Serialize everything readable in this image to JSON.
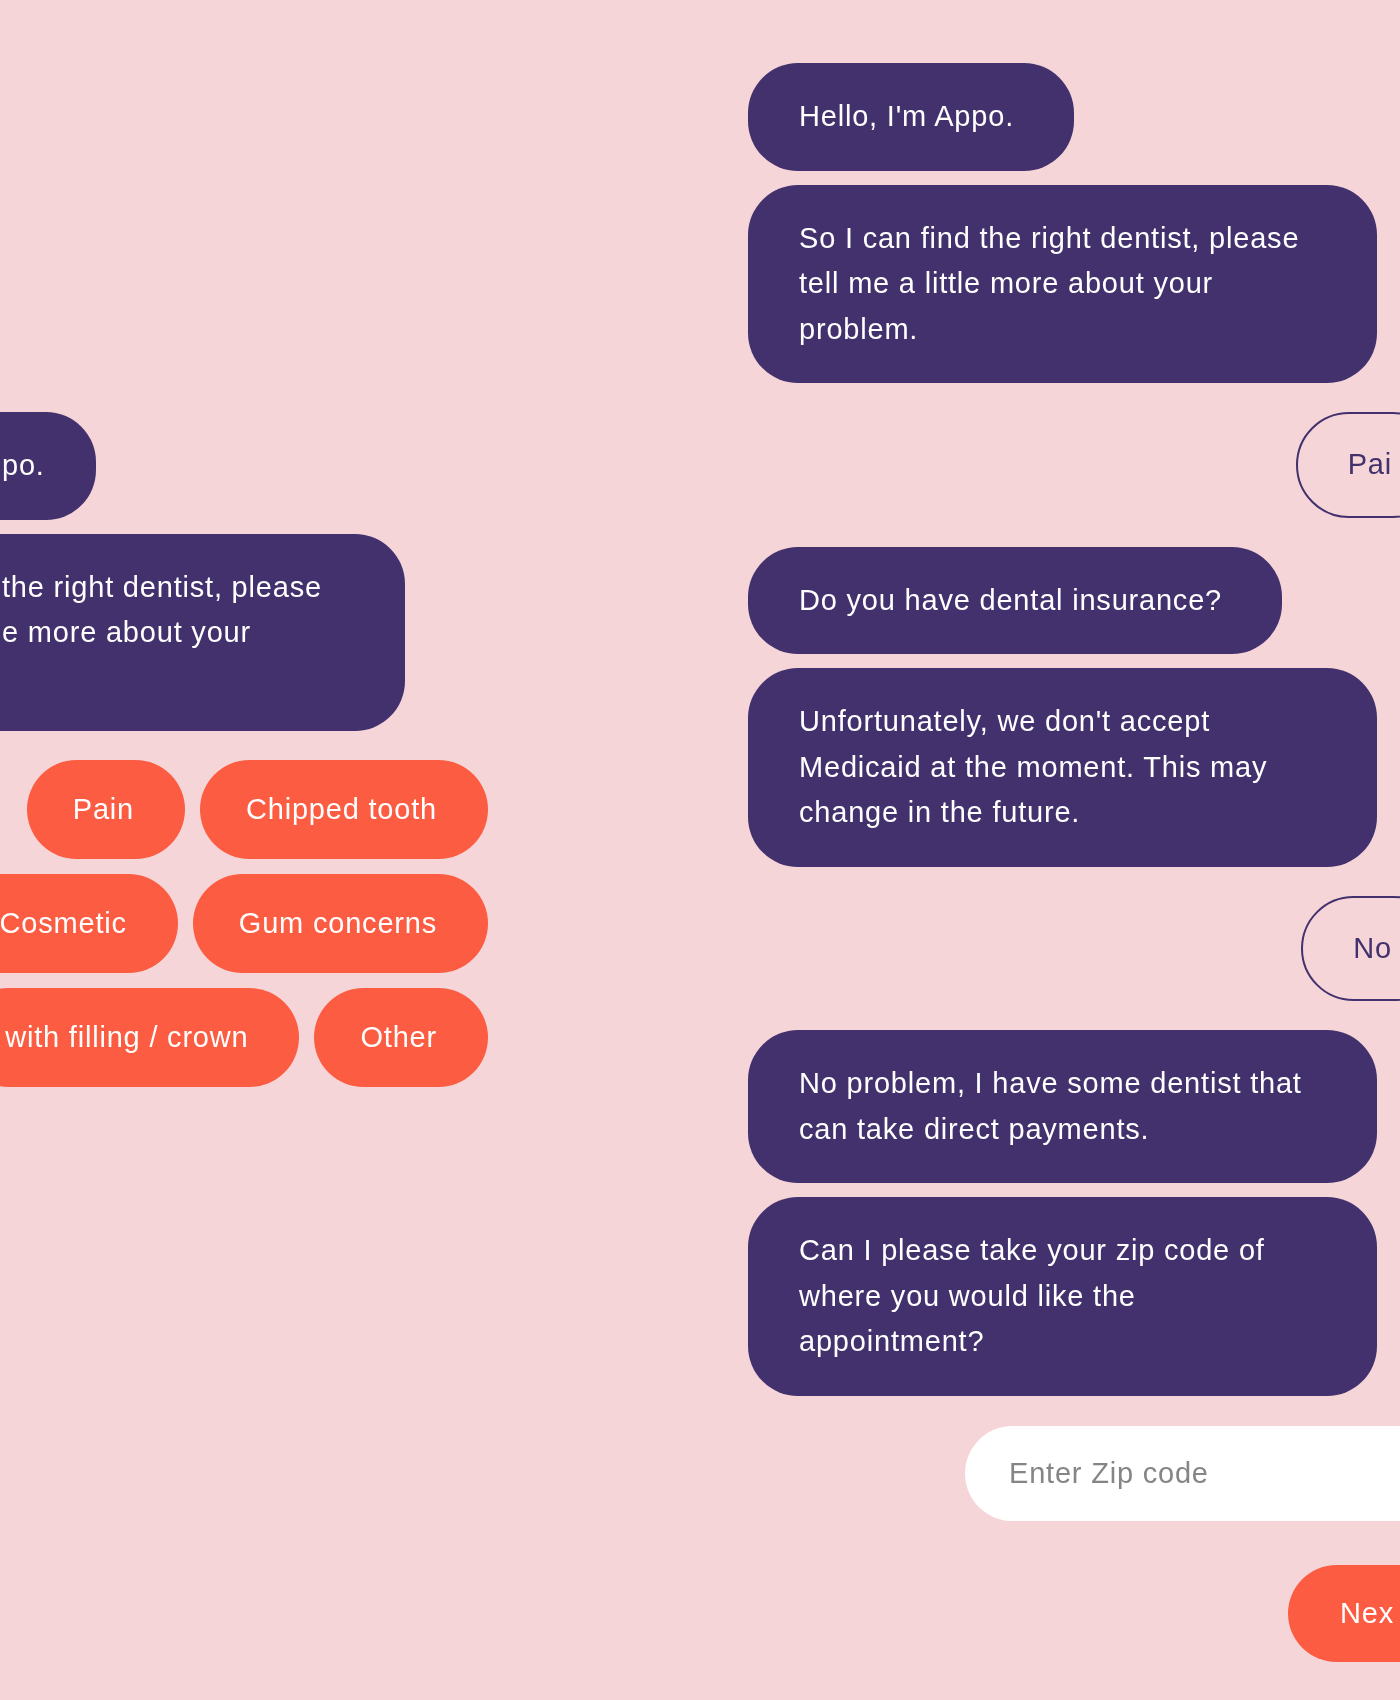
{
  "left_panel": {
    "messages": [
      {
        "kind": "bot",
        "text": "po."
      },
      {
        "kind": "bot",
        "text": "the right dentist, please e more about your"
      }
    ],
    "option_rows": [
      [
        "Pain",
        "Chipped tooth"
      ],
      [
        "Cosmetic",
        "Gum concerns"
      ],
      [
        "with filling / crown",
        "Other"
      ]
    ]
  },
  "chat": {
    "messages": [
      {
        "kind": "bot",
        "text": "Hello, I'm Appo."
      },
      {
        "kind": "bot",
        "text": "So I can find the right dentist, please tell me a little more about your problem."
      },
      {
        "kind": "reply",
        "text": "Pai"
      },
      {
        "kind": "bot",
        "text": "Do you have dental insurance?"
      },
      {
        "kind": "bot",
        "text": "Unfortunately, we don't accept Medicaid at the moment. This may change in the future."
      },
      {
        "kind": "reply",
        "text": "No"
      },
      {
        "kind": "bot",
        "text": "No problem, I have some dentist that can take direct payments."
      },
      {
        "kind": "bot",
        "text": "Can I please take your zip code of where you would like the appointment?"
      }
    ],
    "zip_field": {
      "placeholder": "Enter Zip code"
    },
    "next_button": {
      "label": "Nex"
    }
  }
}
